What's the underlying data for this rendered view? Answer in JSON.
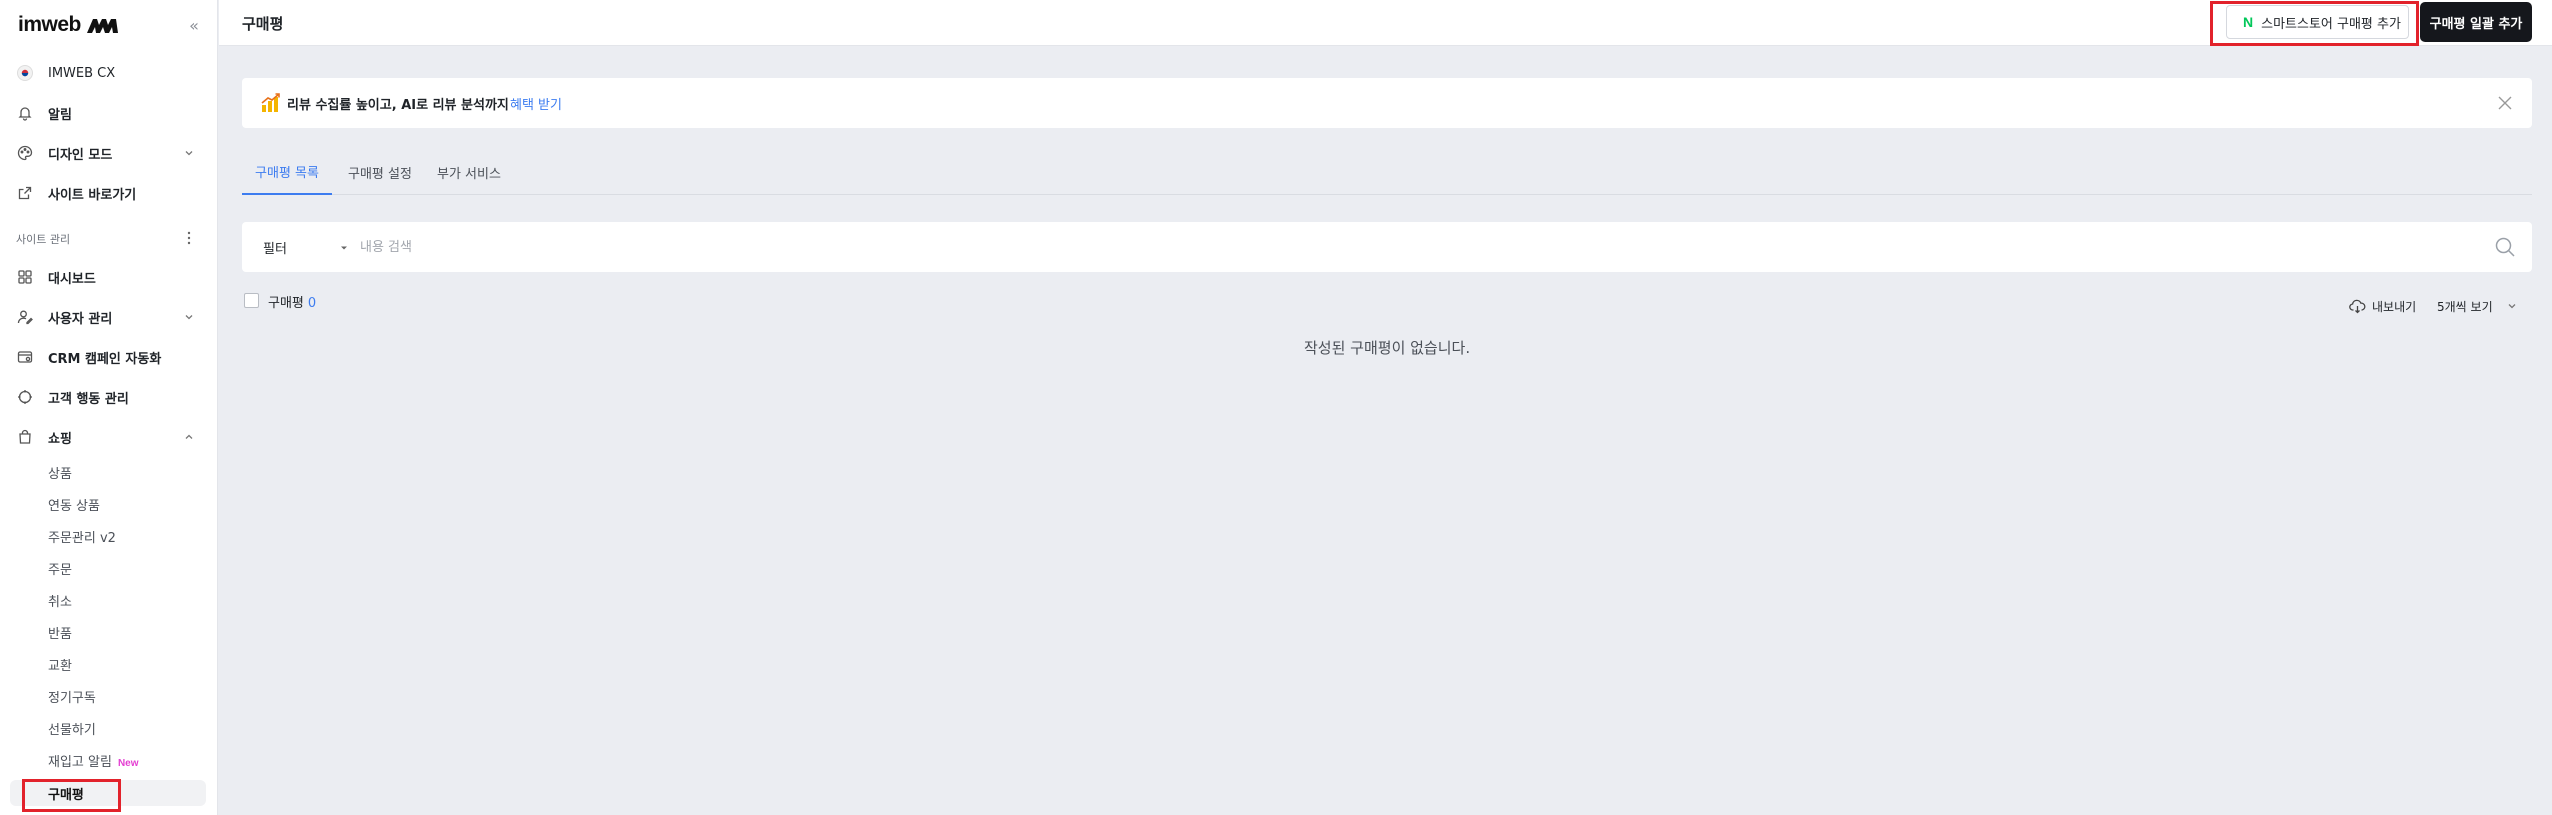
{
  "brand": {
    "logo_text": "imweb"
  },
  "sidebar": {
    "workspace": "IMWEB CX",
    "top_items": [
      {
        "label": "알림",
        "icon": "bell-icon"
      },
      {
        "label": "디자인 모드",
        "icon": "palette-icon"
      },
      {
        "label": "사이트 바로가기",
        "icon": "external-link-icon"
      }
    ],
    "section_label": "사이트 관리",
    "manage_items": [
      {
        "label": "대시보드",
        "icon": "dashboard-icon"
      },
      {
        "label": "사용자 관리",
        "icon": "user-manage-icon"
      },
      {
        "label": "CRM 캠페인 자동화",
        "icon": "crm-icon"
      },
      {
        "label": "고객 행동 관리",
        "icon": "target-icon"
      },
      {
        "label": "쇼핑",
        "icon": "shopping-bag-icon"
      }
    ],
    "shopping_sub": [
      {
        "label": "상품"
      },
      {
        "label": "연동 상품"
      },
      {
        "label": "주문관리 v2"
      },
      {
        "label": "주문"
      },
      {
        "label": "취소"
      },
      {
        "label": "반품"
      },
      {
        "label": "교환"
      },
      {
        "label": "정기구독"
      },
      {
        "label": "선물하기"
      },
      {
        "label": "재입고 알림",
        "badge": "New"
      },
      {
        "label": "구매평"
      }
    ]
  },
  "header": {
    "title": "구매평",
    "smartstore_btn": "스마트스토어 구매평 추가",
    "smartstore_logo": "N",
    "bulk_btn": "구매평 일괄 추가"
  },
  "banner": {
    "message": "리뷰 수집률 높이고, AI로 리뷰 분석까지",
    "link": "혜택 받기"
  },
  "tabs": [
    {
      "label": "구매평 목록",
      "active": true
    },
    {
      "label": "구매평 설정",
      "active": false
    },
    {
      "label": "부가 서비스",
      "active": false
    }
  ],
  "filter": {
    "label": "필터",
    "search_placeholder": "내용 검색",
    "search_value": ""
  },
  "list": {
    "count_label": "구매평",
    "count": "0",
    "export": "내보내기",
    "per_page": "5개씩 보기",
    "empty": "작성된 구매평이 없습니다."
  },
  "colors": {
    "accent": "#3c7cf0",
    "naver_green": "#03c75a",
    "highlight_red": "#e2222b",
    "new_badge": "#e43fd2"
  }
}
